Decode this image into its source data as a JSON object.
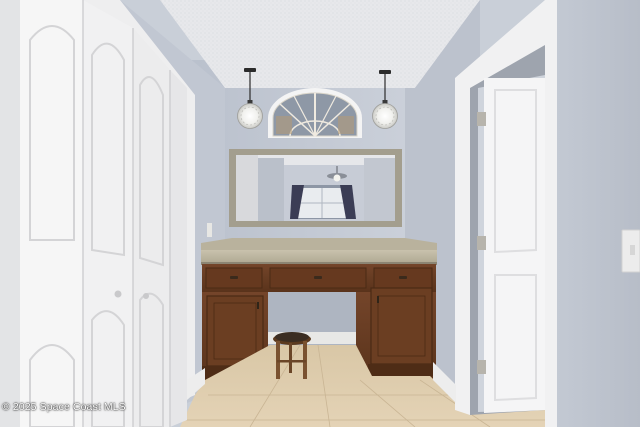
{
  "photo": {
    "watermark": "© 2025 Space Coast MLS",
    "palette": {
      "wall": "#c8ced9",
      "ceiling": "#e8e9ec",
      "door_white": "#f4f4f5",
      "cabinet_wood": "#6b3f22",
      "cabinet_dark": "#4e2c16",
      "countertop": "#bdb6a2",
      "floor_tile": "#dcc9a8",
      "mirror_frame": "#a39e8e"
    }
  }
}
